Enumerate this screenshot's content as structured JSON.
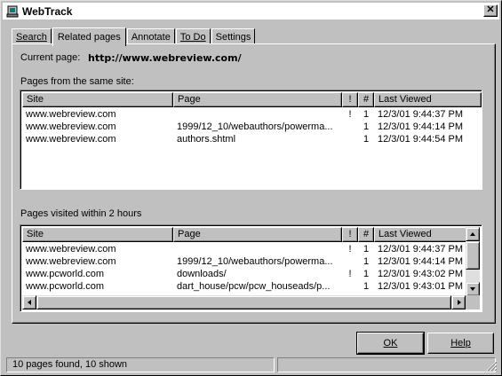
{
  "window": {
    "title": "WebTrack"
  },
  "tabs": [
    {
      "label": "Search",
      "active": false
    },
    {
      "label": "Related pages",
      "active": true
    },
    {
      "label": "Annotate",
      "active": false
    },
    {
      "label": "To Do",
      "active": false
    },
    {
      "label": "Settings",
      "active": false
    }
  ],
  "current_page": {
    "label": "Current page:",
    "url": "http://www.webreview.com/"
  },
  "same_site": {
    "label": "Pages from the same site:",
    "columns": [
      "Site",
      "Page",
      "!",
      "#",
      "Last Viewed"
    ],
    "rows": [
      {
        "site": "www.webreview.com",
        "page": "",
        "flag": "!",
        "count": "1",
        "last": "12/3/01 9:44:37 PM"
      },
      {
        "site": "www.webreview.com",
        "page": "1999/12_10/webauthors/powerma...",
        "flag": "",
        "count": "1",
        "last": "12/3/01 9:44:14 PM"
      },
      {
        "site": "www.webreview.com",
        "page": "authors.shtml",
        "flag": "",
        "count": "1",
        "last": "12/3/01 9:44:54 PM"
      }
    ]
  },
  "recent": {
    "label": "Pages visited within 2 hours",
    "columns": [
      "Site",
      "Page",
      "!",
      "#",
      "Last Viewed"
    ],
    "rows": [
      {
        "site": "www.webreview.com",
        "page": "",
        "flag": "!",
        "count": "1",
        "last": "12/3/01 9:44:37 PM"
      },
      {
        "site": "www.webreview.com",
        "page": "1999/12_10/webauthors/powerma...",
        "flag": "",
        "count": "1",
        "last": "12/3/01 9:44:14 PM"
      },
      {
        "site": "www.pcworld.com",
        "page": "downloads/",
        "flag": "!",
        "count": "1",
        "last": "12/3/01 9:43:02 PM"
      },
      {
        "site": "www.pcworld.com",
        "page": "dart_house/pcw/pcw_houseads/p...",
        "flag": "",
        "count": "1",
        "last": "12/3/01 9:43:01 PM"
      }
    ]
  },
  "buttons": {
    "ok": "OK",
    "help": "Help"
  },
  "status": {
    "text": "10 pages found, 10 shown"
  },
  "icons": {
    "app": "webtrack-app-icon",
    "close": "close-icon"
  }
}
